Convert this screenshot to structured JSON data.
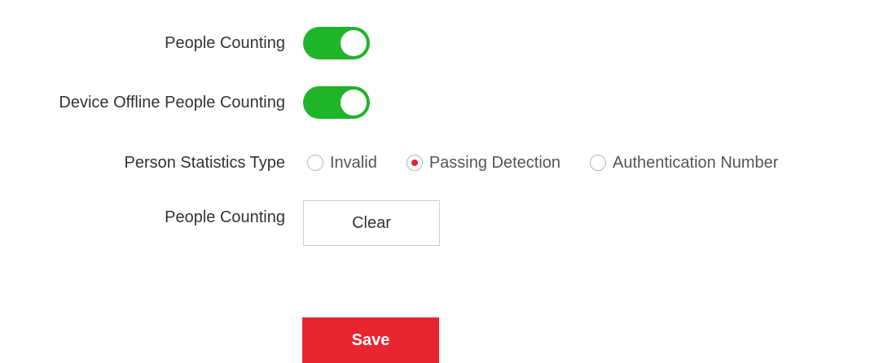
{
  "settings": {
    "people_counting": {
      "label": "People Counting",
      "enabled": true
    },
    "device_offline_people_counting": {
      "label": "Device Offline People Counting",
      "enabled": true
    },
    "person_statistics_type": {
      "label": "Person Statistics Type",
      "options": [
        {
          "label": "Invalid",
          "checked": false
        },
        {
          "label": "Passing Detection",
          "checked": true
        },
        {
          "label": "Authentication Number",
          "checked": false
        }
      ]
    },
    "people_counting_clear": {
      "label": "People Counting",
      "button_label": "Clear"
    }
  },
  "actions": {
    "save_label": "Save"
  },
  "colors": {
    "toggle_on": "#1fb42a",
    "radio_selected": "#e2242e",
    "save_button": "#e8262f"
  }
}
